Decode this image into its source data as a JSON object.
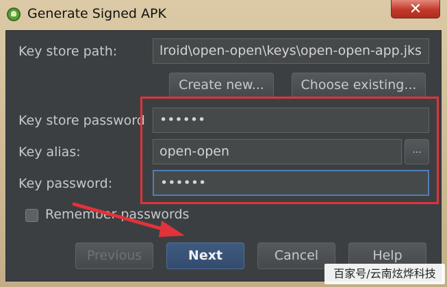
{
  "window": {
    "title": "Generate Signed APK",
    "close_glyph": "✕"
  },
  "form": {
    "keystore_path_label": "Key store path:",
    "keystore_path_value": "lroid\\open-open\\keys\\open-open-app.jks",
    "create_new_label": "Create new...",
    "choose_existing_label": "Choose existing...",
    "keystore_password_label": "Key store password",
    "keystore_password_value": "••••••",
    "key_alias_label": "Key alias:",
    "key_alias_value": "open-open",
    "browse_label": "...",
    "key_password_label": "Key password:",
    "key_password_value": "••••••",
    "remember_label": "Remember passwords",
    "remember_checked": false
  },
  "footer": {
    "previous_label": "Previous",
    "next_label": "Next",
    "cancel_label": "Cancel",
    "help_label": "Help"
  },
  "watermark": {
    "text": "百家号/云南炫烨科技"
  },
  "colors": {
    "dialog_bg": "#3c3f41",
    "highlight_red": "#e2323a",
    "primary_blue": "#3f5a80"
  }
}
